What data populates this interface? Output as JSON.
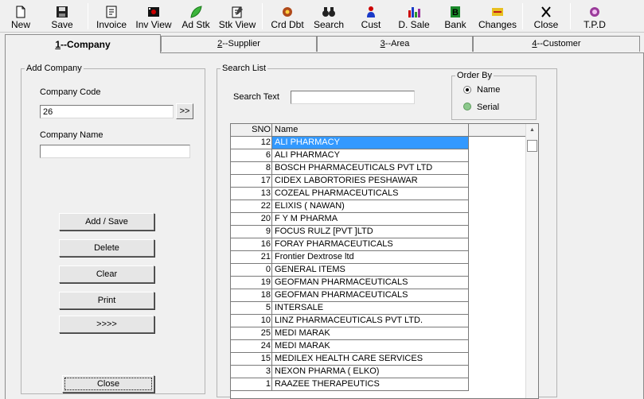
{
  "toolbar": {
    "items": [
      {
        "label": "New",
        "icon": "new-page-icon"
      },
      {
        "label": "Save",
        "icon": "floppy-disk-icon"
      },
      {
        "label": "Invoice",
        "icon": "invoice-icon"
      },
      {
        "label": "Inv View",
        "icon": "video-camera-icon"
      },
      {
        "label": "Ad Stk",
        "icon": "leaf-icon"
      },
      {
        "label": "Stk View",
        "icon": "document-pen-icon"
      },
      {
        "label": "Crd Dbt",
        "icon": "gear-star-icon"
      },
      {
        "label": "Search",
        "icon": "binoculars-icon"
      },
      {
        "label": "Cust",
        "icon": "person-icon"
      },
      {
        "label": "D. Sale",
        "icon": "bar-chart-icon"
      },
      {
        "label": "Bank",
        "icon": "bank-b-icon"
      },
      {
        "label": "Changes",
        "icon": "changes-icon"
      },
      {
        "label": "Close",
        "icon": "close-x-icon"
      },
      {
        "label": "T.P.D",
        "icon": "tpd-icon"
      }
    ]
  },
  "tabs": [
    {
      "key": "1",
      "label": "--Company"
    },
    {
      "key": "2",
      "label": "--Supplier"
    },
    {
      "key": "3",
      "label": "--Area"
    },
    {
      "key": "4",
      "label": "--Customer"
    }
  ],
  "add_company": {
    "legend": "Add Company",
    "code_label": "Company Code",
    "code_value": "26",
    "browse_label": ">>",
    "name_label": "Company Name",
    "name_value": "",
    "buttons": {
      "add_save": "Add / Save",
      "delete": "Delete",
      "clear": "Clear",
      "print": "Print",
      "next": ">>>>",
      "close": "Close"
    }
  },
  "search_list": {
    "legend": "Search List",
    "search_label": "Search  Text",
    "search_value": "",
    "order_by": {
      "legend": "Order By",
      "options": [
        {
          "label": "Name",
          "selected": true
        },
        {
          "label": "Serial",
          "selected": false
        }
      ]
    },
    "columns": [
      "SNO",
      "Name"
    ],
    "rows": [
      {
        "sno": "12",
        "name": "ALI PHARMACY"
      },
      {
        "sno": "6",
        "name": "ALI PHARMACY"
      },
      {
        "sno": "8",
        "name": "BOSCH PHARMACEUTICALS PVT LTD"
      },
      {
        "sno": "17",
        "name": "CIDEX LABORTORIES PESHAWAR"
      },
      {
        "sno": "13",
        "name": "COZEAL PHARMACEUTICALS"
      },
      {
        "sno": "22",
        "name": "ELIXIS ( NAWAN)"
      },
      {
        "sno": "20",
        "name": "F Y M PHARMA"
      },
      {
        "sno": "9",
        "name": "FOCUS RULZ [PVT ]LTD"
      },
      {
        "sno": "16",
        "name": "FORAY PHARMACEUTICALS"
      },
      {
        "sno": "21",
        "name": "Frontier Dextrose ltd"
      },
      {
        "sno": "0",
        "name": "GENERAL ITEMS"
      },
      {
        "sno": "19",
        "name": "GEOFMAN PHARMACEUTICALS"
      },
      {
        "sno": "18",
        "name": "GEOFMAN PHARMACEUTICALS"
      },
      {
        "sno": "5",
        "name": "INTERSALE"
      },
      {
        "sno": "10",
        "name": "LINZ PHARMACEUTICALS PVT LTD."
      },
      {
        "sno": "25",
        "name": "MEDI MARAK"
      },
      {
        "sno": "24",
        "name": "MEDI MARAK"
      },
      {
        "sno": "15",
        "name": "MEDILEX HEALTH CARE SERVICES"
      },
      {
        "sno": "3",
        "name": "NEXON PHARMA ( ELKO)"
      },
      {
        "sno": "1",
        "name": "RAAZEE THERAPEUTICS"
      }
    ],
    "selected_index": 0
  },
  "colors": {
    "selection": "#3399ff",
    "background": "#f0f0f0"
  }
}
